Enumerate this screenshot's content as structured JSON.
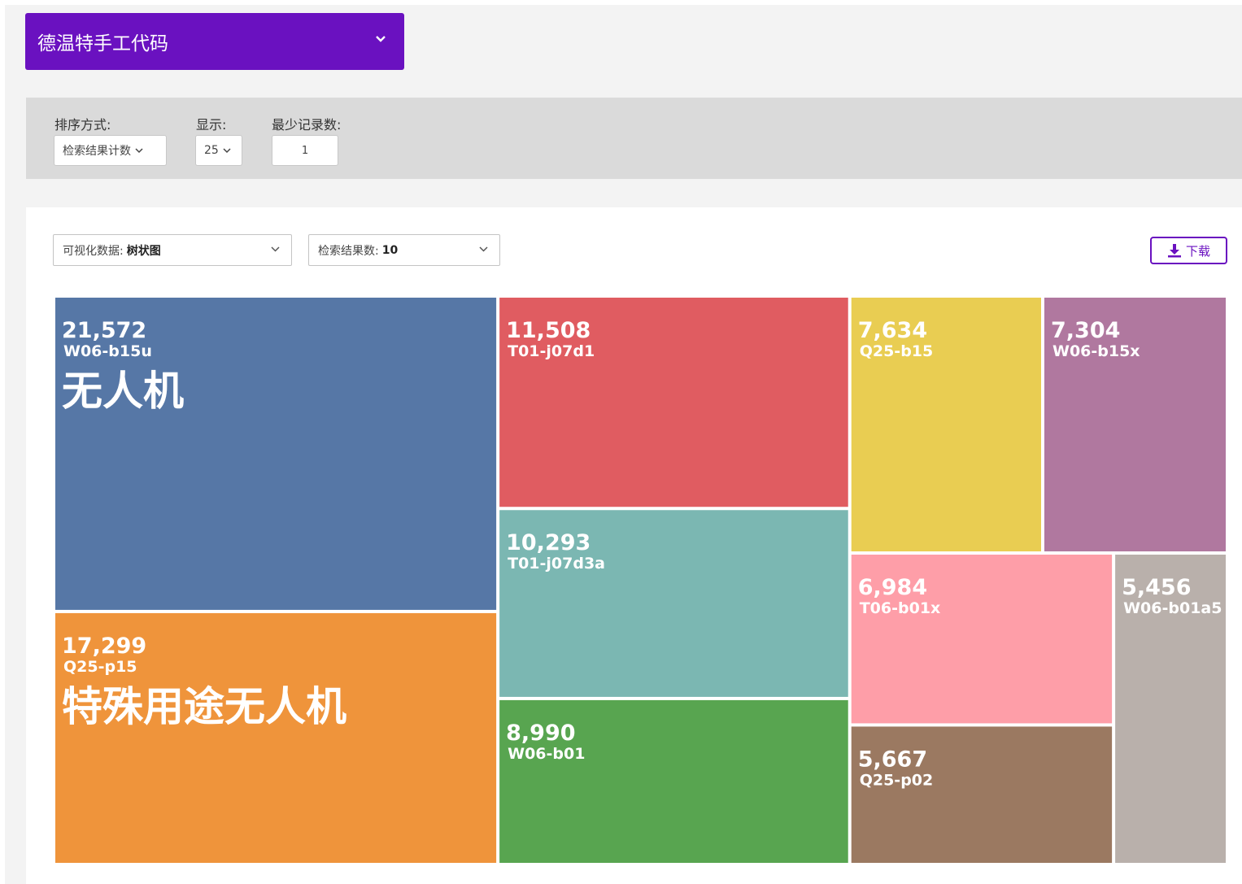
{
  "header": {
    "code_select_label": "德温特手工代码"
  },
  "filters": {
    "sort_label": "排序方式:",
    "sort_value": "检索结果计数",
    "show_label": "显示:",
    "show_value": "25",
    "min_records_label": "最少记录数:",
    "min_records_value": "1"
  },
  "panel": {
    "viz_label": "可视化数据:",
    "viz_value": "树状图",
    "results_label": "检索结果数:",
    "results_value": "10",
    "download_label": "下载"
  },
  "chart_data": {
    "type": "treemap",
    "title": "",
    "items": [
      {
        "code": "W06-b15u",
        "value": 21572,
        "label": "21,572",
        "desc": "无人机",
        "color": "#5677a6"
      },
      {
        "code": "Q25-p15",
        "value": 17299,
        "label": "17,299",
        "desc": "特殊用途无人机",
        "color": "#ef943b"
      },
      {
        "code": "T01-j07d1",
        "value": 11508,
        "label": "11,508",
        "desc": "",
        "color": "#e05c61"
      },
      {
        "code": "T01-j07d3a",
        "value": 10293,
        "label": "10,293",
        "desc": "",
        "color": "#7bb7b2"
      },
      {
        "code": "W06-b01",
        "value": 8990,
        "label": "8,990",
        "desc": "",
        "color": "#58a550"
      },
      {
        "code": "Q25-b15",
        "value": 7634,
        "label": "7,634",
        "desc": "",
        "color": "#e9cd52"
      },
      {
        "code": "W06-b15x",
        "value": 7304,
        "label": "7,304",
        "desc": "",
        "color": "#b0789f"
      },
      {
        "code": "T06-b01x",
        "value": 6984,
        "label": "6,984",
        "desc": "",
        "color": "#fe9ea8"
      },
      {
        "code": "Q25-p02",
        "value": 5667,
        "label": "5,667",
        "desc": "",
        "color": "#9b7961"
      },
      {
        "code": "W06-b01a5",
        "value": 5456,
        "label": "5,456",
        "desc": "",
        "color": "#b9b0ab"
      }
    ]
  }
}
